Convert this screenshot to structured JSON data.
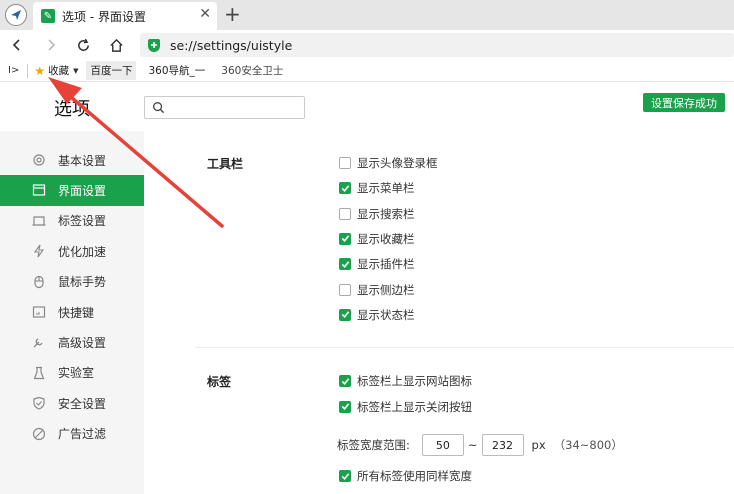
{
  "browser": {
    "tab_title": "选项 - 界面设置",
    "url": "se://settings/uistyle",
    "bookmarks": {
      "favorites_label": "收藏",
      "items": [
        "百度一下",
        "360导航_一",
        "360安全卫士"
      ]
    }
  },
  "settings": {
    "title": "选项",
    "search_placeholder": "",
    "save_status": "设置保存成功",
    "sidebar": [
      {
        "label": "基本设置",
        "icon": "gear-icon",
        "active": false
      },
      {
        "label": "界面设置",
        "icon": "window-icon",
        "active": true
      },
      {
        "label": "标签设置",
        "icon": "tab-icon",
        "active": false
      },
      {
        "label": "优化加速",
        "icon": "lightning-icon",
        "active": false
      },
      {
        "label": "鼠标手势",
        "icon": "mouse-icon",
        "active": false
      },
      {
        "label": "快捷键",
        "icon": "keyboard-icon",
        "active": false
      },
      {
        "label": "高级设置",
        "icon": "wrench-icon",
        "active": false
      },
      {
        "label": "实验室",
        "icon": "flask-icon",
        "active": false
      },
      {
        "label": "安全设置",
        "icon": "shield-icon",
        "active": false
      },
      {
        "label": "广告过滤",
        "icon": "block-icon",
        "active": false
      }
    ],
    "toolbar_section": {
      "label": "工具栏",
      "options": [
        {
          "label": "显示头像登录框",
          "checked": false
        },
        {
          "label": "显示菜单栏",
          "checked": true
        },
        {
          "label": "显示搜索栏",
          "checked": false
        },
        {
          "label": "显示收藏栏",
          "checked": true
        },
        {
          "label": "显示插件栏",
          "checked": true
        },
        {
          "label": "显示侧边栏",
          "checked": false
        },
        {
          "label": "显示状态栏",
          "checked": true
        }
      ]
    },
    "tabs_section": {
      "label": "标签",
      "options": [
        {
          "label": "标签栏上显示网站图标",
          "checked": true
        },
        {
          "label": "标签栏上显示关闭按钮",
          "checked": true
        }
      ],
      "width_label": "标签宽度范围:",
      "width_min": "50",
      "width_sep": "~",
      "width_max": "232",
      "width_unit": "px",
      "width_hint": "（34~800）",
      "same_width": {
        "label": "所有标签使用同样宽度",
        "checked": true
      }
    }
  },
  "colors": {
    "accent": "#1aa14b",
    "annotation_arrow": "#e8413a"
  }
}
